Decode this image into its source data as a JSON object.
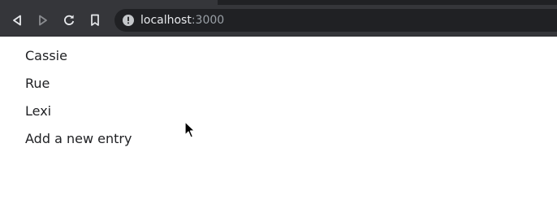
{
  "browser": {
    "url_host": "localhost",
    "url_port": ":3000",
    "buttons": {
      "back": "back-icon",
      "forward": "forward-icon",
      "reload": "reload-icon",
      "bookmark": "bookmark-icon"
    },
    "info_icon": "info-icon"
  },
  "page": {
    "items": [
      "Cassie",
      "Rue",
      "Lexi"
    ],
    "add_entry_label": "Add a new entry"
  }
}
